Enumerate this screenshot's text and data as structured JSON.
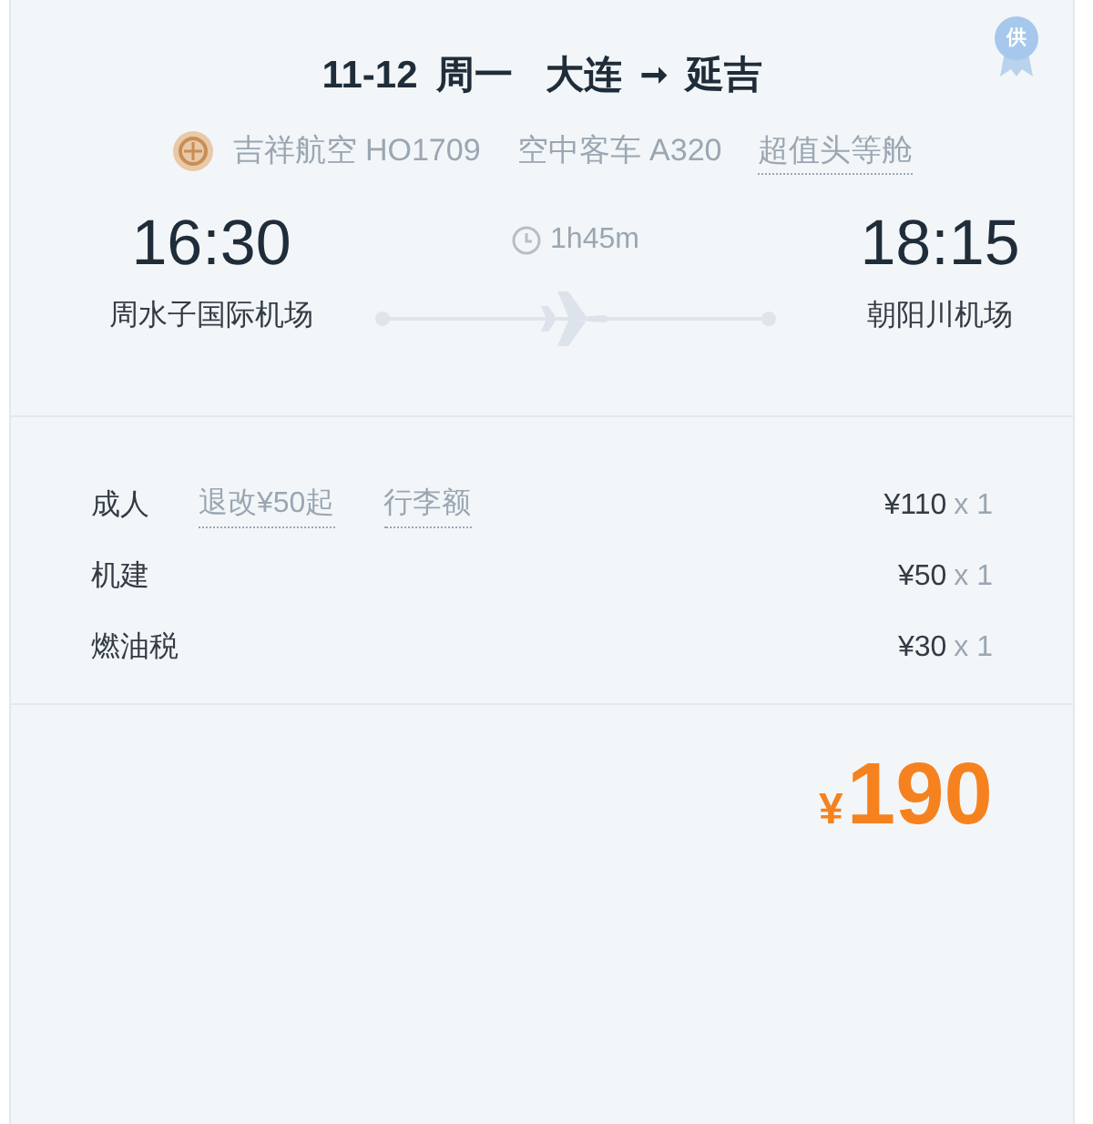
{
  "badge": "供",
  "header": {
    "date": "11-12",
    "weekday": "周一",
    "from": "大连",
    "arrow": "➞",
    "to": "延吉"
  },
  "flight": {
    "airline": "吉祥航空 HO1709",
    "aircraft": "空中客车 A320",
    "cabin": "超值头等舱"
  },
  "depart": {
    "time": "16:30",
    "airport": "周水子国际机场"
  },
  "duration": "1h45m",
  "arrive": {
    "time": "18:15",
    "airport": "朝阳川机场"
  },
  "fees": [
    {
      "label": "成人",
      "links": [
        "退改¥50起",
        "行李额"
      ],
      "price": "¥110",
      "qty": "x 1"
    },
    {
      "label": "机建",
      "price": "¥50",
      "qty": "x 1"
    },
    {
      "label": "燃油税",
      "price": "¥30",
      "qty": "x 1"
    }
  ],
  "total": {
    "currency": "¥",
    "amount": "190"
  }
}
